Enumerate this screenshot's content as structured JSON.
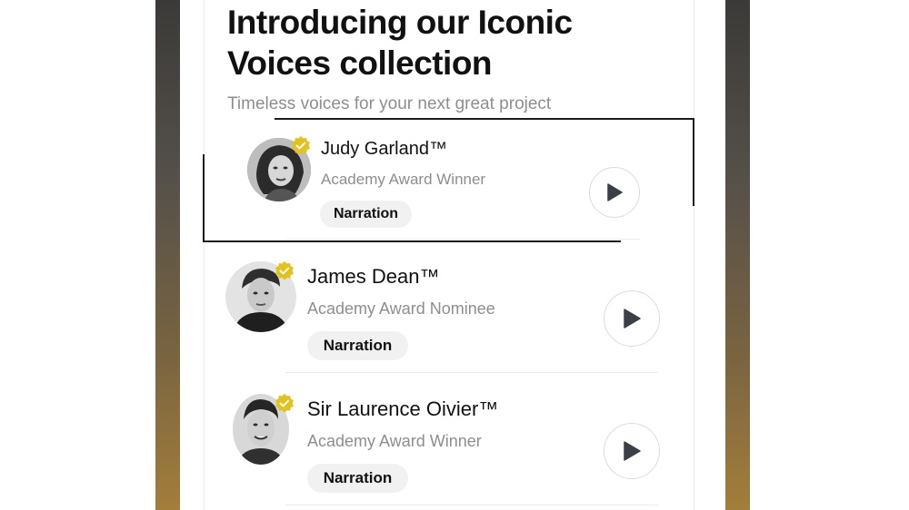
{
  "header": {
    "title": "Introducing our Iconic\nVoices collection",
    "subtitle": "Timeless voices for your next great project"
  },
  "voices": [
    {
      "name": "Judy Garland™",
      "award": "Academy Award Winner",
      "tag": "Narration",
      "avatar_icon": "portrait-judy-garland",
      "verified_icon": "verified-badge-icon",
      "play_icon": "play-icon"
    },
    {
      "name": "James Dean™",
      "award": "Academy Award Nominee",
      "tag": "Narration",
      "avatar_icon": "portrait-james-dean",
      "verified_icon": "verified-badge-icon",
      "play_icon": "play-icon"
    },
    {
      "name": "Sir Laurence Oivier™",
      "award": "Academy Award Winner",
      "tag": "Narration",
      "avatar_icon": "portrait-laurence-olivier",
      "verified_icon": "verified-badge-icon",
      "play_icon": "play-icon"
    }
  ],
  "colors": {
    "verified_badge": "#e3c21b",
    "play_icon": "#3b4046",
    "tag_background": "#f1f1f1",
    "secondary_text": "#8e8e8e"
  }
}
